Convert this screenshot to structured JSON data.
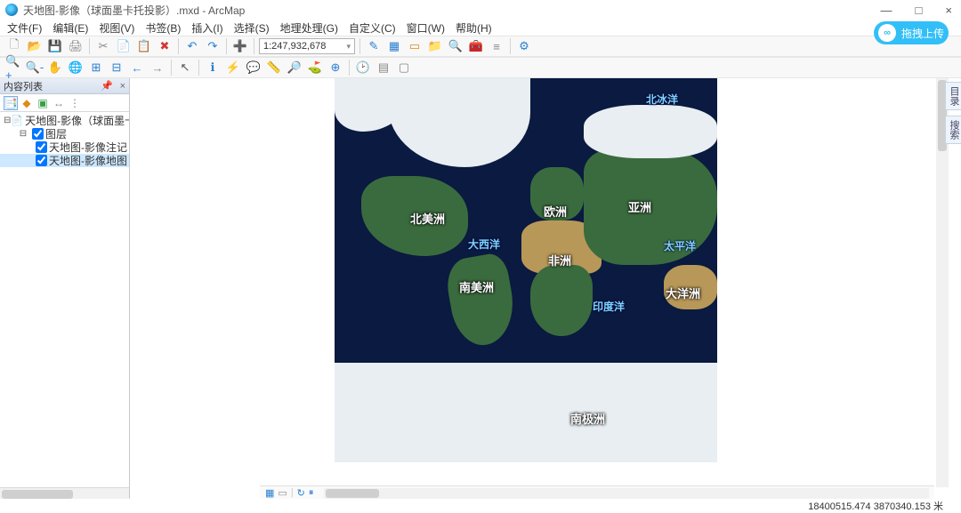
{
  "window": {
    "title": "天地图-影像（球面墨卡托投影）.mxd - ArcMap",
    "min": "—",
    "max": "□",
    "close": "×"
  },
  "menubar": [
    "文件(F)",
    "编辑(E)",
    "视图(V)",
    "书签(B)",
    "插入(I)",
    "选择(S)",
    "地理处理(G)",
    "自定义(C)",
    "窗口(W)",
    "帮助(H)"
  ],
  "upload_label": "拖拽上传",
  "scale": "1:247,932,678",
  "toc_title": "内容列表",
  "tree": {
    "root": "天地图-影像（球面墨卡托投",
    "frame": "图层",
    "layer_anno": "天地图-影像注记（球",
    "layer_img": "天地图-影像地图（球"
  },
  "map_labels": {
    "n_america": "北美洲",
    "s_america": "南美洲",
    "europe": "欧洲",
    "africa": "非洲",
    "asia": "亚洲",
    "oceania": "大洋洲",
    "antarctica": "南极洲",
    "arctic": "北冰洋",
    "atlantic": "大西洋",
    "pacific": "太平洋",
    "indian": "印度洋"
  },
  "right_tabs": [
    "目录",
    "搜索"
  ],
  "status": "18400515.474 3870340.153 米",
  "icons": {
    "new": "🗋",
    "open": "📂",
    "save": "💾",
    "print": "🖨",
    "cut": "✂",
    "copy": "📄",
    "paste": "📋",
    "undo": "↶",
    "redo": "↷",
    "add": "➕",
    "zoomin": "🔍+",
    "zoomout": "🔍-",
    "pan": "✋",
    "full": "🌐",
    "fixed": "⌖",
    "back": "←",
    "fwd": "→",
    "ptr": "↖",
    "info": "ℹ",
    "measure": "📏",
    "find": "🔎",
    "xy": "⊕",
    "time": "🕑",
    "edit": "✎",
    "table": "▦",
    "chart": "📊",
    "win": "▭",
    "tbx": "🧰",
    "py": "≡",
    "toc1": "📑",
    "toc2": "◆",
    "toc3": "▣",
    "toc4": "↔"
  }
}
